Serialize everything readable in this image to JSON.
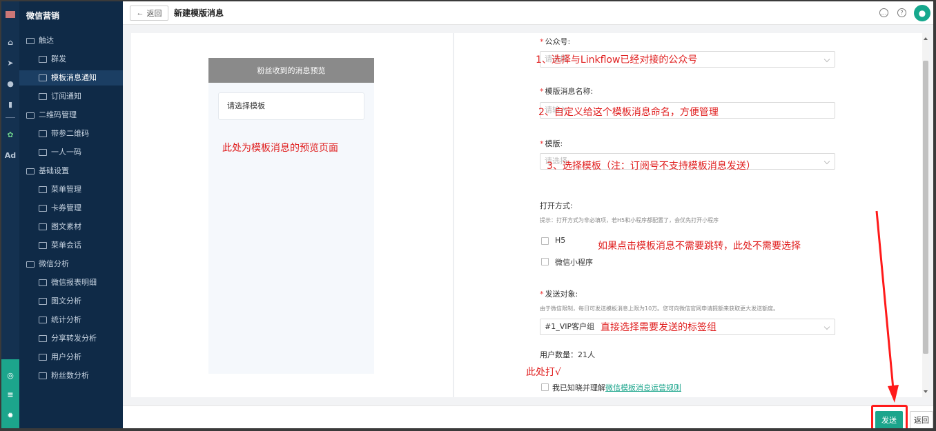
{
  "menu": {
    "title": "微信营销",
    "items": [
      {
        "label": "触达",
        "level": "group"
      },
      {
        "label": "群发",
        "level": "sub"
      },
      {
        "label": "模板消息通知",
        "level": "sub",
        "active": true
      },
      {
        "label": "订阅通知",
        "level": "sub"
      },
      {
        "label": "二维码管理",
        "level": "group"
      },
      {
        "label": "带参二维码",
        "level": "sub"
      },
      {
        "label": "一人一码",
        "level": "sub"
      },
      {
        "label": "基础设置",
        "level": "group"
      },
      {
        "label": "菜单管理",
        "level": "sub"
      },
      {
        "label": "卡券管理",
        "level": "sub"
      },
      {
        "label": "图文素材",
        "level": "sub"
      },
      {
        "label": "菜单会话",
        "level": "sub"
      },
      {
        "label": "微信分析",
        "level": "group"
      },
      {
        "label": "微信报表明细",
        "level": "sub"
      },
      {
        "label": "图文分析",
        "level": "sub"
      },
      {
        "label": "统计分析",
        "level": "sub"
      },
      {
        "label": "分享转发分析",
        "level": "sub"
      },
      {
        "label": "用户分析",
        "level": "sub"
      },
      {
        "label": "粉丝数分析",
        "level": "sub"
      }
    ]
  },
  "rail": {
    "ad_label": "Ad"
  },
  "header": {
    "back_label": "返回",
    "title": "新建模版消息"
  },
  "preview": {
    "header": "粉丝收到的消息预览",
    "placeholder": "请选择模板"
  },
  "form": {
    "account_label": "公众号:",
    "account_placeholder": "请选择",
    "name_label": "模版消息名称:",
    "name_placeholder": "请输入",
    "template_label": "模版:",
    "template_placeholder": "请选择",
    "open_label": "打开方式:",
    "open_hint": "提示：打开方式为非必填项，若H5和小程序都配置了，会优先打开小程序",
    "option_h5": "H5",
    "option_miniprogram": "微信小程序",
    "target_label": "发送对象:",
    "target_hint": "由于微信限制，每日可发送模板消息上限为10万。您可向微信官网申请提额来获取更大发送额度。",
    "target_value": "#1_VIP客户组",
    "user_count": "用户数量：21人",
    "agree_text": "我已知晓并理解",
    "agree_link": "微信模板消息运营规则"
  },
  "annotations": {
    "a1": "1、选择与Linkflow已经对接的公众号",
    "a2": "2、自定义给这个模板消息命名，方便管理",
    "a3": "3、选择模板（注：订阅号不支持模板消息发送）",
    "a4": "如果点击模板消息不需要跳转，此处不需要选择",
    "a5": "直接选择需要发送的标签组",
    "a6": "此处打√",
    "preview_note": "此处为模板消息的预览页面"
  },
  "footer": {
    "send_label": "发送",
    "return_label": "返回"
  },
  "colors": {
    "accent": "#1ca58c",
    "sidebar": "#0f2a47",
    "annotation": "#e02020"
  }
}
